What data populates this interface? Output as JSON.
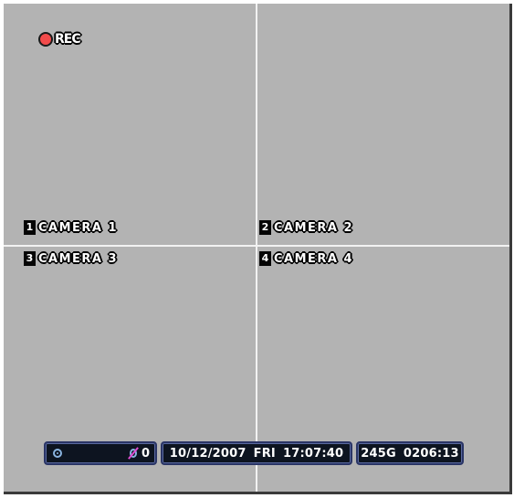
{
  "recording": {
    "label": "REC",
    "indicator_color": "#f24b4b"
  },
  "cameras": [
    {
      "number": "1",
      "name": "CAMERA 1"
    },
    {
      "number": "2",
      "name": "CAMERA 2"
    },
    {
      "number": "3",
      "name": "CAMERA 3"
    },
    {
      "number": "4",
      "name": "CAMERA 4"
    }
  ],
  "status_bar": {
    "disc_icon": "disc-icon",
    "alarm_icon": "alarm-icon",
    "alarm_count": "0",
    "date": "10/12/2007",
    "day": "FRI",
    "time": "17:07:40",
    "storage": "245G",
    "remaining": "0206:13"
  },
  "colors": {
    "video_background": "#b3b3b3",
    "divider": "#f2f2f2",
    "panel_background": "#0d1420",
    "panel_border": "#2a3566"
  }
}
